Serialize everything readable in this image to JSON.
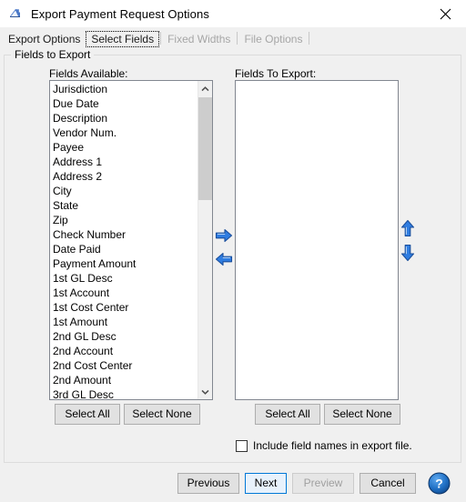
{
  "window": {
    "title": "Export Payment Request Options",
    "app_icon": "export-document-icon",
    "close_icon": "close-icon"
  },
  "tabs": [
    {
      "label": "Export Options",
      "state": "normal"
    },
    {
      "label": "Select Fields",
      "state": "selected"
    },
    {
      "label": "Fixed Widths",
      "state": "disabled"
    },
    {
      "label": "File Options",
      "state": "disabled"
    }
  ],
  "group": {
    "legend": "Fields to Export"
  },
  "available": {
    "label": "Fields Available:",
    "items": [
      "Jurisdiction",
      "Due Date",
      "Description",
      "Vendor Num.",
      "Payee",
      "Address 1",
      "Address 2",
      "City",
      "State",
      "Zip",
      "Check Number",
      "Date Paid",
      "Payment Amount",
      "1st GL Desc",
      "1st Account",
      "1st Cost Center",
      "1st Amount",
      "2nd GL Desc",
      "2nd Account",
      "2nd Cost Center",
      "2nd Amount",
      "3rd GL Desc"
    ],
    "scrollbar": {
      "up_icon": "chevron-up-icon",
      "down_icon": "chevron-down-icon"
    },
    "select_all_label": "Select All",
    "select_none_label": "Select None"
  },
  "export": {
    "label": "Fields To Export:",
    "items": [],
    "select_all_label": "Select All",
    "select_none_label": "Select None"
  },
  "transfer": {
    "add_icon": "arrow-right-icon",
    "remove_icon": "arrow-left-icon",
    "move_up_icon": "arrow-up-icon",
    "move_down_icon": "arrow-down-icon"
  },
  "options": {
    "include_field_names_label": "Include field names in export file.",
    "include_field_names_checked": false
  },
  "footer": {
    "previous_label": "Previous",
    "next_label": "Next",
    "preview_label": "Preview",
    "cancel_label": "Cancel",
    "help_icon": "help-question-icon"
  },
  "colors": {
    "accent_blue": "#0078d7",
    "arrow_blue": "#1a6fd4",
    "window_bg": "#f0f0f0",
    "list_bg": "#ffffff",
    "disabled_text": "#a6a6a6"
  }
}
